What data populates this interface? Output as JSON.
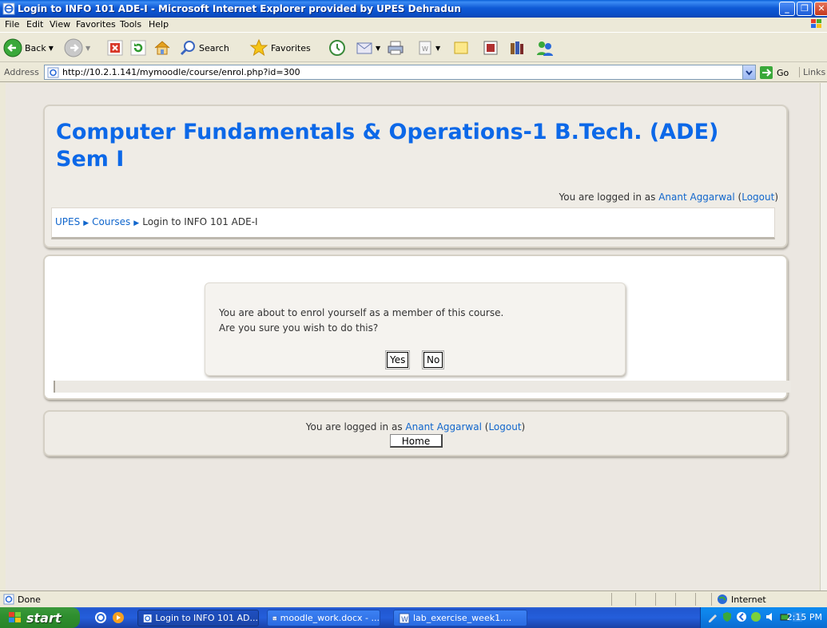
{
  "window": {
    "title": "Login to INFO 101 ADE-I - Microsoft Internet Explorer provided by UPES Dehradun"
  },
  "menu": [
    "File",
    "Edit",
    "View",
    "Favorites",
    "Tools",
    "Help"
  ],
  "toolbar": {
    "back_label": "Back",
    "search_label": "Search",
    "favorites_label": "Favorites"
  },
  "address": {
    "label": "Address",
    "url": "http://10.2.1.141/mymoodle/course/enrol.php?id=300",
    "go_label": "Go",
    "links_label": "Links"
  },
  "page": {
    "course_title": "Computer Fundamentals & Operations-1 B.Tech. (ADE) Sem I",
    "logged_in_prefix": "You are logged in as",
    "user_name": "Anant Aggarwal",
    "logout_label": "Logout",
    "breadcrumb": [
      "UPES",
      "Courses",
      "Login to INFO 101 ADE-I"
    ],
    "confirm_line1": "You are about to enrol yourself as a member of this course.",
    "confirm_line2": "Are you sure you wish to do this?",
    "yes_label": "Yes",
    "no_label": "No",
    "home_label": "Home"
  },
  "status": {
    "text": "Done",
    "zone": "Internet"
  },
  "taskbar": {
    "start_label": "start",
    "tasks": [
      "Login to INFO 101 AD...",
      "moodle_work.docx - ...",
      "lab_exercise_week1...."
    ],
    "clock": "2:15 PM"
  },
  "colors": {
    "link": "#1166cc",
    "title": "#0c68e8",
    "titlebar": "#0a4fc8"
  }
}
